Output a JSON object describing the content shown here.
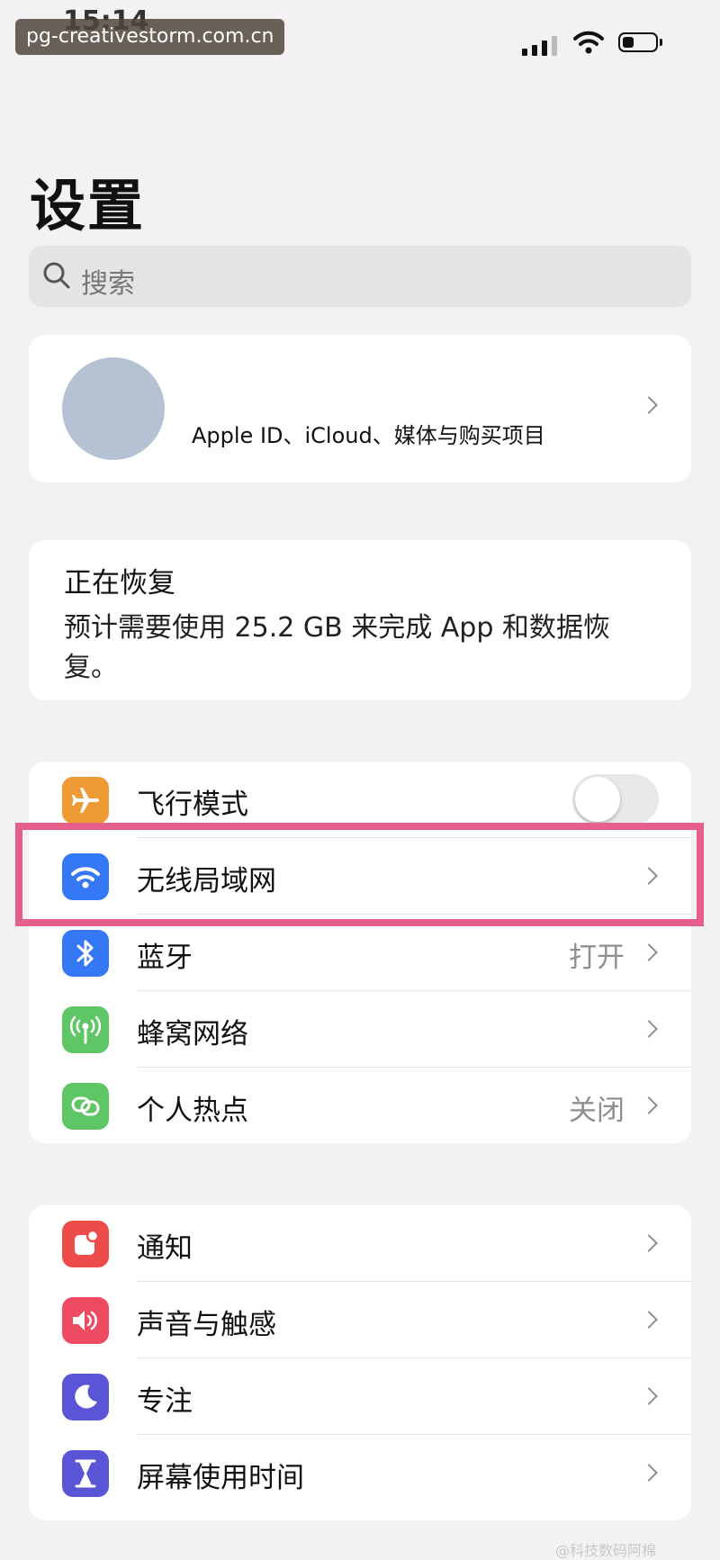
{
  "status_bar": {
    "time": "15:14",
    "watermark": "pg-creativestorm.com.cn",
    "battery_level": 0.3
  },
  "page": {
    "title": "设置"
  },
  "search": {
    "placeholder": "搜索"
  },
  "apple_id": {
    "text": "Apple ID、iCloud、媒体与购买项目"
  },
  "restore": {
    "title": "正在恢复",
    "description": "预计需要使用 25.2 GB 来完成 App 和数据恢复。"
  },
  "group1": [
    {
      "label": "飞行模式",
      "icon": "airplane-icon",
      "color": "#f09a36",
      "toggle": false
    },
    {
      "label": "无线局域网",
      "icon": "wifi-icon",
      "color": "#3478f6",
      "value": ""
    },
    {
      "label": "蓝牙",
      "icon": "bluetooth-icon",
      "color": "#3478f6",
      "value": "打开"
    },
    {
      "label": "蜂窝网络",
      "icon": "cellular-icon",
      "color": "#5ec664",
      "value": ""
    },
    {
      "label": "个人热点",
      "icon": "hotspot-icon",
      "color": "#5ec664",
      "value": "关闭"
    }
  ],
  "group2": [
    {
      "label": "通知",
      "icon": "notification-icon",
      "color": "#ee4b4b"
    },
    {
      "label": "声音与触感",
      "icon": "sound-icon",
      "color": "#ee4b62"
    },
    {
      "label": "专注",
      "icon": "moon-icon",
      "color": "#5a55d6"
    },
    {
      "label": "屏幕使用时间",
      "icon": "hourglass-icon",
      "color": "#5a55d6"
    }
  ],
  "highlight_color": "#e65f8a",
  "footer_watermark": "@科技数码阿棉"
}
